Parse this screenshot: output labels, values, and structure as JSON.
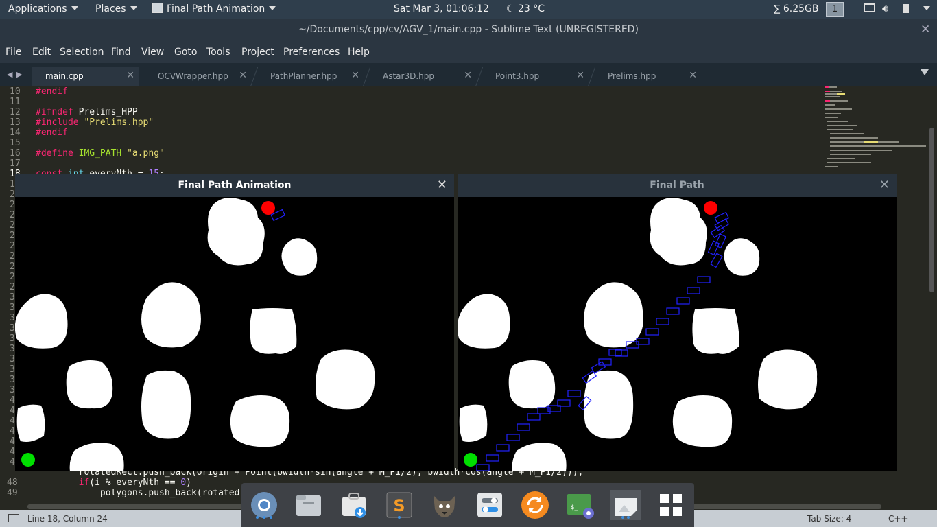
{
  "topbar": {
    "applications": "Applications",
    "places": "Places",
    "active_app": "Final Path Animation",
    "clock": "Sat Mar  3, 01:06:12",
    "weather": "23 °C",
    "memory": "∑ 6.25GB",
    "workspace": "1"
  },
  "editor_window": {
    "title": "~/Documents/cpp/cv/AGV_1/main.cpp - Sublime Text (UNREGISTERED)"
  },
  "menu": [
    "File",
    "Edit",
    "Selection",
    "Find",
    "View",
    "Goto",
    "Tools",
    "Project",
    "Preferences",
    "Help"
  ],
  "tabs": [
    {
      "label": "main.cpp",
      "active": true
    },
    {
      "label": "OCVWrapper.hpp",
      "active": false
    },
    {
      "label": "PathPlanner.hpp",
      "active": false
    },
    {
      "label": "Astar3D.hpp",
      "active": false
    },
    {
      "label": "Point3.hpp",
      "active": false
    },
    {
      "label": "Prelims.hpp",
      "active": false
    }
  ],
  "gutter_numbers": [
    "10",
    "11",
    "12",
    "13",
    "14",
    "15",
    "16",
    "17",
    "18",
    "1",
    "2",
    "2",
    "2",
    "2",
    "2",
    "2",
    "2",
    "2",
    "2",
    "2",
    "3",
    "3",
    "3",
    "3",
    "3",
    "3",
    "3",
    "3",
    "3",
    "3",
    "4",
    "4",
    "4",
    "4",
    "4",
    "4",
    "4",
    "48",
    "49"
  ],
  "code_top": [
    "#endif",
    "",
    "#ifndef Prelims_HPP",
    "#include \"Prelims.hpp\"",
    "#endif",
    "",
    "#define IMG_PATH \"a.png\"",
    "",
    "const int everyNth = 15;"
  ],
  "code_bottom": [
    "        rotatedRect.push_back(origin + Point(bwidth*sin(angle + M_PI/2), bwidth*cos(angle + M_PI/2)));",
    "        if(i % everyNth == 0)",
    "            polygons.push_back(rotated"
  ],
  "windows": {
    "animation_title": "Final Path Animation",
    "final_title": "Final Path"
  },
  "status": {
    "position": "Line 18, Column 24",
    "tab_size": "Tab Size: 4",
    "syntax": "C++"
  },
  "colors": {
    "start_marker": "#00e000",
    "goal_marker": "#ff0000",
    "path_rect": "#1a1aff",
    "obstacle": "#ffffff"
  },
  "dock_icons": [
    "chromium-icon",
    "files-icon",
    "software-center-icon",
    "sublime-text-icon",
    "gimp-icon",
    "settings-icon",
    "update-icon",
    "terminal-icon",
    "screenshot-icon",
    "app-grid-icon"
  ]
}
